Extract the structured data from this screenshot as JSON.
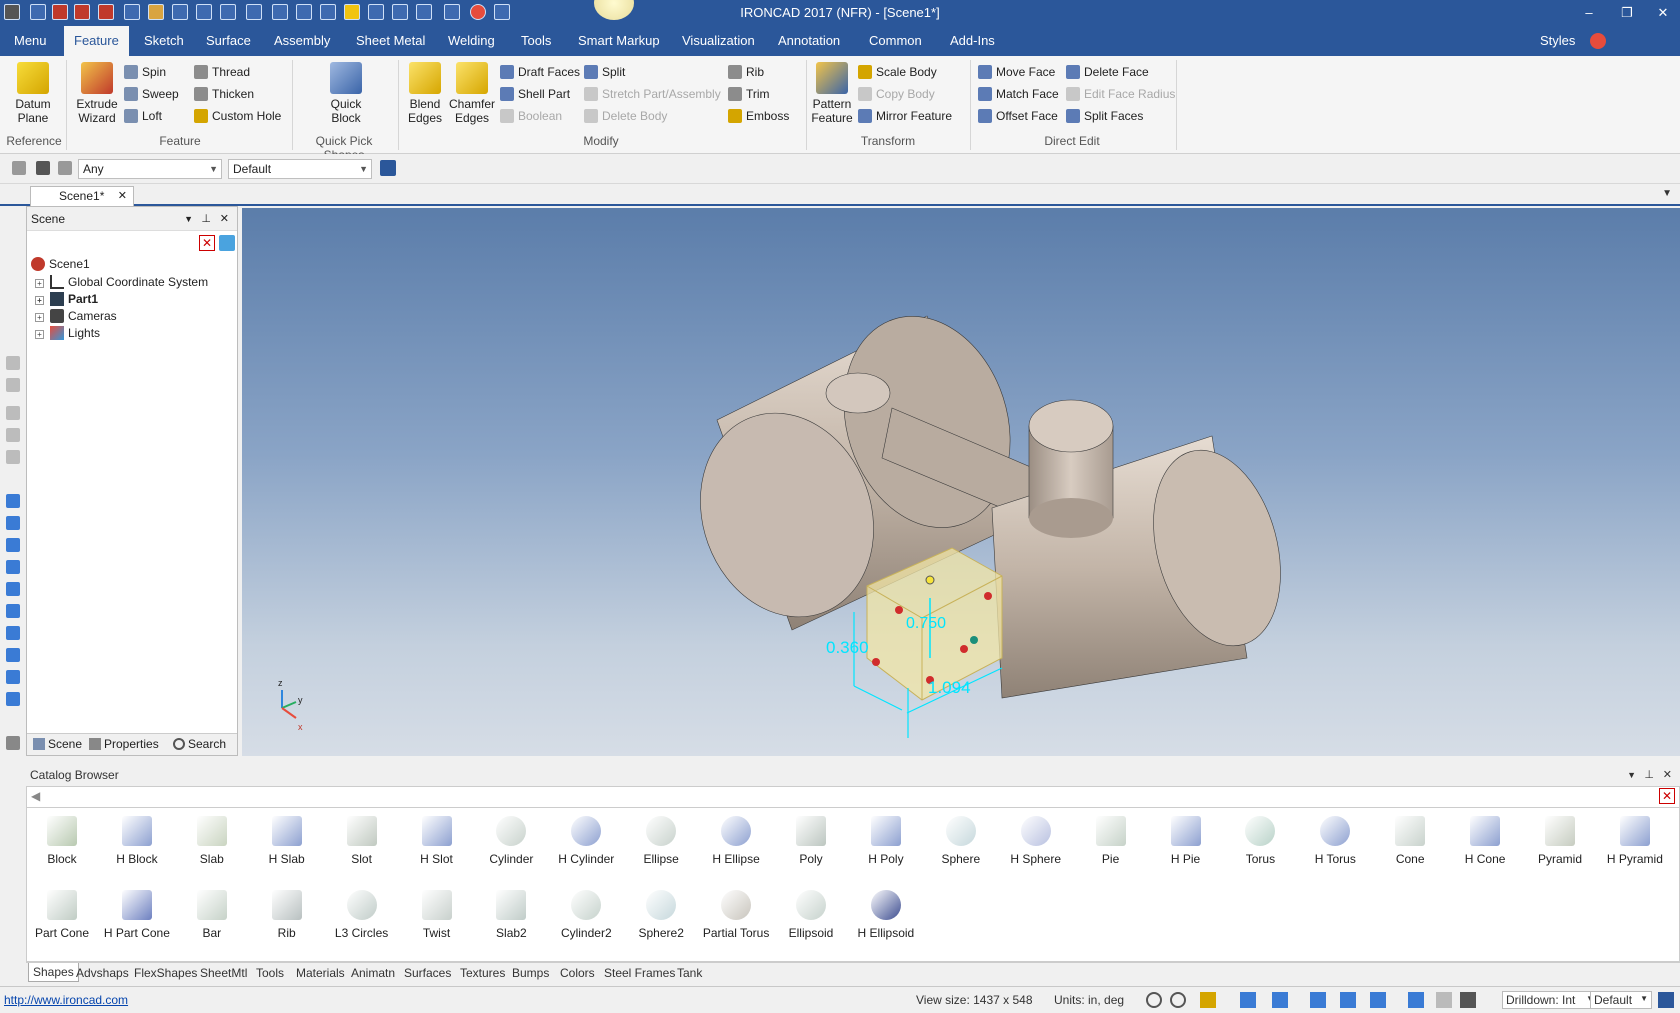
{
  "window": {
    "title": "IRONCAD 2017 (NFR) - [Scene1*]",
    "min_glyph": "–",
    "restore_glyph": "❐",
    "close_glyph": "✕"
  },
  "menu": {
    "tabs": [
      "Menu",
      "Feature",
      "Sketch",
      "Surface",
      "Assembly",
      "Sheet Metal",
      "Welding",
      "Tools",
      "Smart Markup",
      "Visualization",
      "Annotation",
      "Common",
      "Add-Ins"
    ],
    "active": "Feature",
    "styles_label": "Styles"
  },
  "ribbon": {
    "reference": {
      "label": "Reference",
      "datum_plane": [
        "Datum",
        "Plane"
      ]
    },
    "feature": {
      "label": "Feature",
      "extrude_wizard": [
        "Extrude",
        "Wizard"
      ],
      "spin": "Spin",
      "sweep": "Sweep",
      "loft": "Loft",
      "thread": "Thread",
      "thicken": "Thicken",
      "custom_hole": "Custom Hole"
    },
    "quick_pick": {
      "label": "Quick Pick Shapes",
      "quick_block": [
        "Quick",
        "Block"
      ]
    },
    "modify": {
      "label": "Modify",
      "blend_edges": [
        "Blend",
        "Edges"
      ],
      "chamfer_edges": [
        "Chamfer",
        "Edges"
      ],
      "draft_faces": "Draft Faces",
      "shell_part": "Shell Part",
      "boolean": "Boolean",
      "split": "Split",
      "stretch": "Stretch Part/Assembly",
      "delete_body": "Delete Body",
      "rib": "Rib",
      "trim": "Trim",
      "emboss": "Emboss"
    },
    "transform": {
      "label": "Transform",
      "pattern_feature": [
        "Pattern",
        "Feature"
      ],
      "scale_body": "Scale Body",
      "copy_body": "Copy Body",
      "mirror_feature": "Mirror Feature"
    },
    "direct_edit": {
      "label": "Direct Edit",
      "move_face": "Move Face",
      "match_face": "Match Face",
      "offset_face": "Offset Face",
      "delete_face": "Delete Face",
      "edit_face_radius": "Edit Face Radius",
      "split_faces": "Split Faces"
    }
  },
  "selection_bar": {
    "filter": "Any",
    "style": "Default"
  },
  "document_tab": "Scene1*",
  "scene_panel": {
    "title": "Scene",
    "tree": [
      {
        "label": "Scene1",
        "bold": false,
        "level": 0
      },
      {
        "label": "Global Coordinate System",
        "bold": false,
        "level": 1
      },
      {
        "label": "Part1",
        "bold": true,
        "level": 1
      },
      {
        "label": "Cameras",
        "bold": false,
        "level": 1
      },
      {
        "label": "Lights",
        "bold": false,
        "level": 1
      }
    ],
    "tabs": [
      "Scene",
      "Properties",
      "Search"
    ]
  },
  "viewport": {
    "dimension_height": "0.360",
    "dimension_depth": "0.750",
    "dimension_width": "1.094",
    "triad": {
      "z": "z",
      "y": "y",
      "x": "x"
    }
  },
  "catalog": {
    "title": "Catalog Browser",
    "shapes": [
      "Block",
      "H Block",
      "Slab",
      "H Slab",
      "Slot",
      "H Slot",
      "Cylinder",
      "H Cylinder",
      "Ellipse",
      "H Ellipse",
      "Poly",
      "H Poly",
      "Sphere",
      "H Sphere",
      "Pie",
      "H Pie",
      "Torus",
      "H Torus",
      "Cone",
      "H Cone",
      "Pyramid",
      "H Pyramid",
      "Part Cone",
      "H Part Cone",
      "Bar",
      "Rib",
      "L3 Circles",
      "Twist",
      "Slab2",
      "Cylinder2",
      "Sphere2",
      "Partial Torus",
      "Ellipsoid",
      "H Ellipsoid"
    ],
    "tabs": [
      "Shapes",
      "Advshaps",
      "FlexShapes",
      "SheetMtl",
      "Tools",
      "Materials",
      "Animatn",
      "Surfaces",
      "Textures",
      "Bumps",
      "Colors",
      "Steel Frames",
      "Tank"
    ],
    "active_tab": "Shapes"
  },
  "status": {
    "link": "http://www.ironcad.com",
    "view_size": "View size: 1437 x  548",
    "units": "Units: in, deg",
    "drilldown": "Drilldown: Int",
    "style": "Default"
  },
  "colors": {
    "accent": "#2b579a",
    "part": "#cdbfb3",
    "dimension": "#00e5ff"
  }
}
